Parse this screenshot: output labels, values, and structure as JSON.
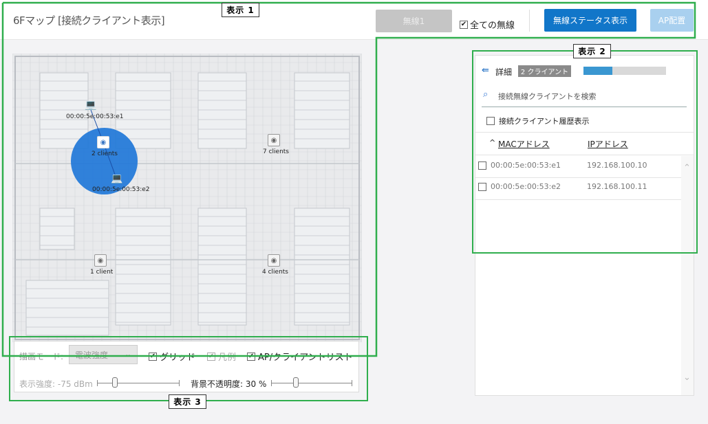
{
  "header": {
    "title": "6Fマップ [接続クライアント表示]",
    "wireless1_button": "無線1",
    "all_wireless_label": "全ての無線",
    "status_button": "無線ステータス表示",
    "ap_button": "AP配置"
  },
  "map": {
    "aps": [
      {
        "label": "2 clients",
        "icon": "wifi-icon",
        "active": true
      },
      {
        "label": "7 clients",
        "icon": "wifi-icon"
      },
      {
        "label": "1 client",
        "icon": "wifi-icon"
      },
      {
        "label": "4 clients",
        "icon": "wifi-icon"
      }
    ],
    "clients": [
      {
        "mac": "00:00:5e:00:53:e1",
        "icon": "laptop-icon"
      },
      {
        "mac": "00:00:5e:00:53:e2",
        "icon": "laptop-icon"
      }
    ],
    "coverage_color": "#1f77d8"
  },
  "settings": {
    "mode_label": "描画モード:",
    "mode_value": "電波強度",
    "grid_label": "グリッド",
    "legend_label": "凡例",
    "list_label": "AP/クライアントリスト",
    "strength_label": "表示強度: -75 dBm",
    "opacity_label": "背景不透明度: 30 %"
  },
  "panel": {
    "detail_label": "詳細",
    "client_badge": "2 クライアント",
    "progress": 0.35,
    "search_placeholder": "接続無線クライアントを検索",
    "history_label": "接続クライアント履歴表示",
    "col_mac": "MACアドレス",
    "col_ip": "IPアドレス",
    "rows": [
      {
        "mac": "00:00:5e:00:53:e1",
        "ip": "192.168.100.10"
      },
      {
        "mac": "00:00:5e:00:53:e2",
        "ip": "192.168.100.11"
      }
    ]
  },
  "annotations": {
    "label1": "表示 1",
    "label2": "表示 2",
    "label3": "表示 3"
  },
  "colors": {
    "highlight": "#2fae4d",
    "primary": "#1176c9",
    "progress": "#3a97d1"
  }
}
